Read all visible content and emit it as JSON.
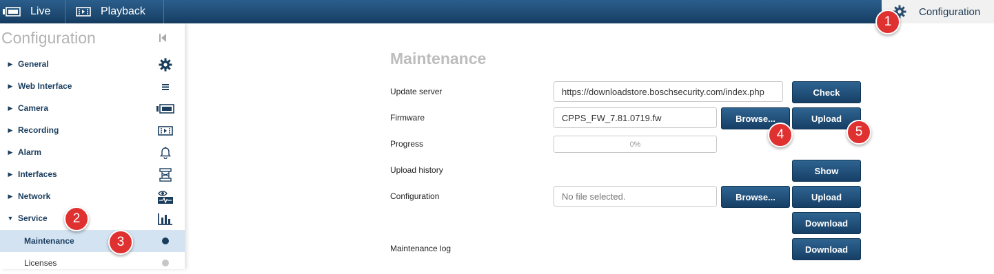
{
  "topbar": {
    "live_label": "Live",
    "playback_label": "Playback",
    "configuration_label": "Configuration"
  },
  "sidebar": {
    "title": "Configuration",
    "items": [
      {
        "label": "General",
        "icon": "gear-icon"
      },
      {
        "label": "Web Interface",
        "icon": "menu-icon"
      },
      {
        "label": "Camera",
        "icon": "camera-icon"
      },
      {
        "label": "Recording",
        "icon": "recording-icon"
      },
      {
        "label": "Alarm",
        "icon": "bell-icon"
      },
      {
        "label": "Interfaces",
        "icon": "interfaces-icon"
      },
      {
        "label": "Network",
        "icon": "network-icon"
      },
      {
        "label": "Service",
        "icon": "service-chart-icon"
      }
    ],
    "subitems": [
      {
        "label": "Maintenance",
        "active": true
      },
      {
        "label": "Licenses",
        "active": false
      }
    ]
  },
  "callouts": [
    "1",
    "2",
    "3",
    "4",
    "5"
  ],
  "main": {
    "title": "Maintenance",
    "update_server": {
      "label": "Update server",
      "value": "https://downloadstore.boschsecurity.com/index.php",
      "button": "Check"
    },
    "firmware": {
      "label": "Firmware",
      "value": "CPPS_FW_7.81.0719.fw",
      "browse": "Browse...",
      "upload": "Upload"
    },
    "progress": {
      "label": "Progress",
      "text": "0%",
      "fraction": 0
    },
    "upload_history": {
      "label": "Upload history",
      "button": "Show"
    },
    "configuration": {
      "label": "Configuration",
      "placeholder": "No file selected.",
      "browse": "Browse...",
      "upload": "Upload",
      "download": "Download"
    },
    "maintenance_log": {
      "label": "Maintenance log",
      "button": "Download"
    }
  },
  "colors": {
    "topbar": "#1f4a74",
    "accent": "#2b5e8c",
    "callout": "#e03131",
    "active_row": "#d3e3f1"
  }
}
